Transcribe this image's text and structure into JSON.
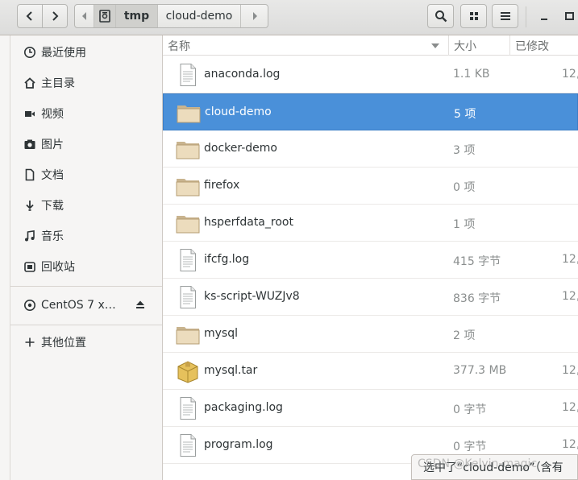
{
  "pathbar": {
    "segments": [
      "tmp",
      "cloud-demo"
    ]
  },
  "sidebar": {
    "items": [
      {
        "label": "最近使用",
        "icon": "clock-icon"
      },
      {
        "label": "主目录",
        "icon": "home-icon"
      },
      {
        "label": "视频",
        "icon": "video-icon"
      },
      {
        "label": "图片",
        "icon": "camera-icon"
      },
      {
        "label": "文档",
        "icon": "document-icon"
      },
      {
        "label": "下载",
        "icon": "download-icon"
      },
      {
        "label": "音乐",
        "icon": "music-icon"
      },
      {
        "label": "回收站",
        "icon": "trash-icon"
      }
    ],
    "device": {
      "label": "CentOS 7 x…",
      "icon": "disc-icon"
    },
    "other": {
      "label": "其他位置",
      "icon": "plus-icon"
    }
  },
  "columns": {
    "name": "名称",
    "size": "大小",
    "modified": "已修改"
  },
  "files": [
    {
      "name": "anaconda.log",
      "size": "1.1 KB",
      "modified": "12,",
      "type": "file"
    },
    {
      "name": "cloud-demo",
      "size": "5 项",
      "modified": "",
      "type": "folder",
      "selected": true
    },
    {
      "name": "docker-demo",
      "size": "3 项",
      "modified": "",
      "type": "folder"
    },
    {
      "name": "firefox",
      "size": "0 项",
      "modified": "",
      "type": "folder"
    },
    {
      "name": "hsperfdata_root",
      "size": "1 项",
      "modified": "",
      "type": "folder"
    },
    {
      "name": "ifcfg.log",
      "size": "415 字节",
      "modified": "12,",
      "type": "file"
    },
    {
      "name": "ks-script-WUZJv8",
      "size": "836 字节",
      "modified": "12,",
      "type": "file"
    },
    {
      "name": "mysql",
      "size": "2 项",
      "modified": "",
      "type": "folder"
    },
    {
      "name": "mysql.tar",
      "size": "377.3 MB",
      "modified": "12,",
      "type": "archive"
    },
    {
      "name": "packaging.log",
      "size": "0 字节",
      "modified": "12,",
      "type": "file"
    },
    {
      "name": "program.log",
      "size": "0 字节",
      "modified": "12,",
      "type": "file"
    }
  ],
  "statusbar": {
    "text": "选中了“cloud-demo”（含有"
  },
  "watermark": {
    "text": "CSDN @Kelvin-magic"
  }
}
